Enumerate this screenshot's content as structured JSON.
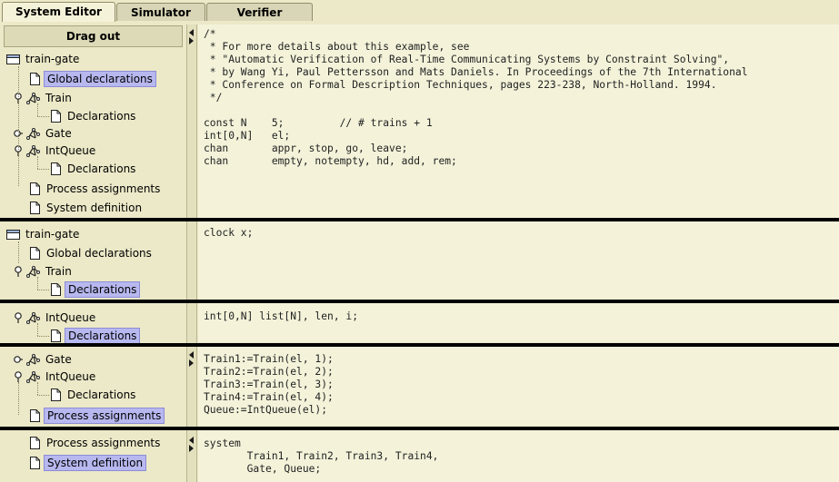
{
  "tabs": [
    {
      "label": "System Editor"
    },
    {
      "label": "Simulator"
    },
    {
      "label": "Verifier"
    }
  ],
  "drag_out_label": "Drag out",
  "panes": [
    {
      "tree": {
        "root": "train-gate",
        "global": "Global declarations",
        "train": "Train",
        "train_decl": "Declarations",
        "gate": "Gate",
        "intqueue": "IntQueue",
        "intqueue_decl": "Declarations",
        "process": "Process assignments",
        "system": "System definition"
      },
      "code": "/*\n * For more details about this example, see\n * \"Automatic Verification of Real-Time Communicating Systems by Constraint Solving\",\n * by Wang Yi, Paul Pettersson and Mats Daniels. In Proceedings of the 7th International\n * Conference on Formal Description Techniques, pages 223-238, North-Holland. 1994.\n */\n\nconst N    5;         // # trains + 1\nint[0,N]   el;\nchan       appr, stop, go, leave;\nchan       empty, notempty, hd, add, rem;"
    },
    {
      "tree": {
        "root": "train-gate",
        "global": "Global declarations",
        "train": "Train",
        "train_decl": "Declarations"
      },
      "code": "clock x;"
    },
    {
      "tree": {
        "intqueue": "IntQueue",
        "intqueue_decl": "Declarations"
      },
      "code": "int[0,N] list[N], len, i;"
    },
    {
      "tree": {
        "gate": "Gate",
        "intqueue": "IntQueue",
        "intqueue_decl": "Declarations",
        "process": "Process assignments"
      },
      "code": "Train1:=Train(el, 1);\nTrain2:=Train(el, 2);\nTrain3:=Train(el, 3);\nTrain4:=Train(el, 4);\nQueue:=IntQueue(el);"
    },
    {
      "tree": {
        "process": "Process assignments",
        "system": "System definition"
      },
      "code": "system\n       Train1, Train2, Train3, Train4,\n       Gate, Queue;"
    }
  ]
}
